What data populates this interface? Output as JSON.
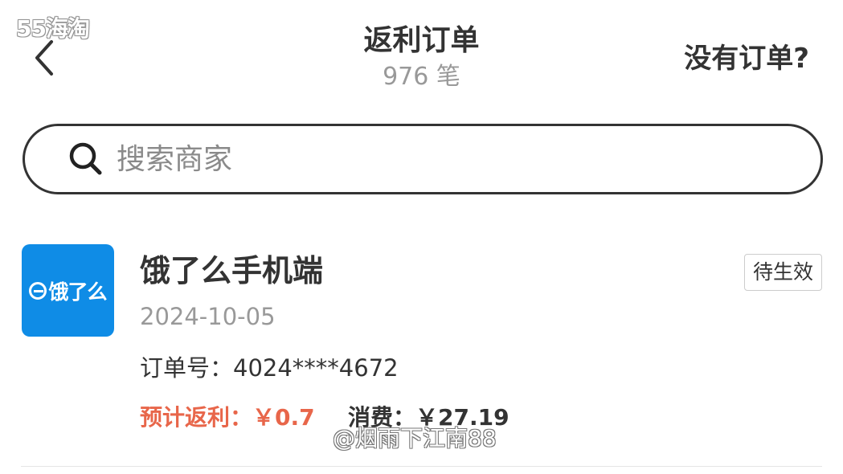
{
  "watermark_top": "55海淘",
  "header": {
    "title": "返利订单",
    "count": "976 笔",
    "no_order_link": "没有订单?"
  },
  "search": {
    "placeholder": "搜索商家",
    "value": ""
  },
  "orders": [
    {
      "merchant": "饿了么手机端",
      "logo_text": "饿了么",
      "date": "2024-10-05",
      "order_no": "订单号：4024****4672",
      "status": "待生效",
      "rebate": "预计返利：￥0.7",
      "spend": "消费：￥27.19"
    }
  ],
  "watermark_bottom": "@烟雨下江南88",
  "colors": {
    "logo_bg": "#0f8ce6",
    "rebate": "#e8664a",
    "text": "#333333",
    "muted": "#999999"
  },
  "icons": {
    "back": "chevron-left-icon",
    "search": "search-icon"
  }
}
